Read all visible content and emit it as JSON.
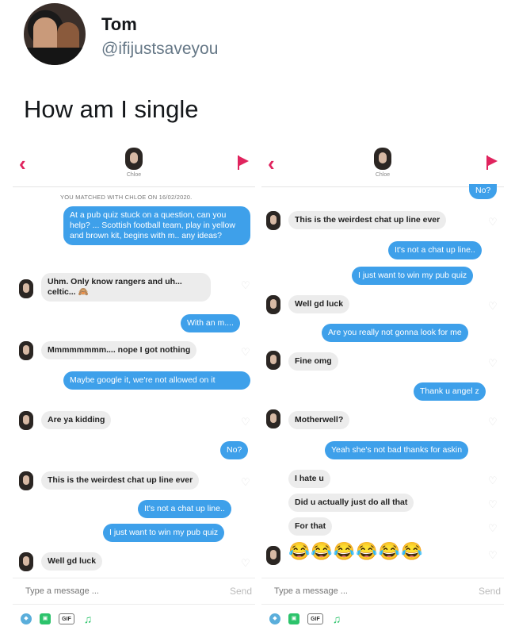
{
  "tweet": {
    "name": "Tom",
    "handle": "@ifijustsaveyou",
    "text": "How am I single"
  },
  "chat": {
    "match_name": "Chloe",
    "matched_note": "YOU MATCHED WITH CHLOE ON 16/02/2020.",
    "compose_placeholder": "Type a message ...",
    "send_label": "Send",
    "gif_label": "GIF"
  },
  "left_messages": [
    {
      "dir": "out",
      "text": "At a pub quiz stuck on a question, can you help? ... Scottish football team, play in yellow and brown kit, begins with m.. any ideas?"
    },
    {
      "dir": "in",
      "text": "Uhm. Only know rangers and uh... celtic... 🙈"
    },
    {
      "dir": "out",
      "text": "With an m...."
    },
    {
      "dir": "in",
      "text": "Mmmmmmmm.... nope I got nothing"
    },
    {
      "dir": "out",
      "text": "Maybe google it, we're not allowed on it"
    },
    {
      "dir": "in",
      "text": "Are ya kidding"
    },
    {
      "dir": "out",
      "text": "No?"
    },
    {
      "dir": "in",
      "text": "This is the weirdest chat up line ever"
    },
    {
      "dir": "out",
      "text": "It's not a chat up line.."
    },
    {
      "dir": "out",
      "text": "I just want to win my pub quiz"
    },
    {
      "dir": "in",
      "text": "Well gd luck"
    }
  ],
  "right_messages": [
    {
      "dir": "out",
      "text": "No?"
    },
    {
      "dir": "in",
      "text": "This is the weirdest chat up line ever"
    },
    {
      "dir": "out",
      "text": "It's not a chat up line.."
    },
    {
      "dir": "out",
      "text": "I just want to win my pub quiz"
    },
    {
      "dir": "in",
      "text": "Well gd luck"
    },
    {
      "dir": "out",
      "text": "Are you really not gonna look for me"
    },
    {
      "dir": "in",
      "text": "Fine omg"
    },
    {
      "dir": "out",
      "text": "Thank u angel z"
    },
    {
      "dir": "in",
      "text": "Motherwell?"
    },
    {
      "dir": "out",
      "text": "Yeah she's not bad thanks for askin"
    },
    {
      "dir": "in",
      "text": "I hate u"
    },
    {
      "dir": "in",
      "text": "Did u actually just do all that"
    },
    {
      "dir": "in",
      "text": "For that"
    },
    {
      "dir": "in",
      "text": "😂😂😂😂😂😂"
    }
  ],
  "colors": {
    "outgoing_bubble": "#3ea0ea",
    "incoming_bubble": "#ececec",
    "accent": "#e0245e"
  },
  "icons": [
    "back-icon",
    "flag-icon",
    "heart-icon",
    "gift-icon",
    "image-icon",
    "gif-icon",
    "music-icon"
  ]
}
